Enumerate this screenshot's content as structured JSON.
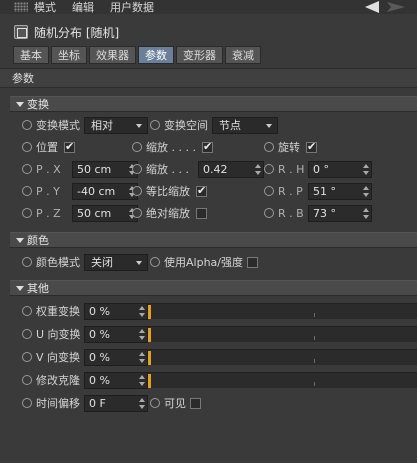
{
  "menu": {
    "items": [
      "模式",
      "编辑",
      "用户数据"
    ]
  },
  "title": "随机分布 [随机]",
  "tabs": [
    {
      "label": "基本",
      "active": false
    },
    {
      "label": "坐标",
      "active": false
    },
    {
      "label": "效果器",
      "active": false
    },
    {
      "label": "参数",
      "active": true
    },
    {
      "label": "变形器",
      "active": false
    },
    {
      "label": "衰减",
      "active": false
    }
  ],
  "params_header": "参数",
  "transform": {
    "header": "变换",
    "mode_label": "变换模式",
    "mode_value": "相对",
    "space_label": "变换空间",
    "space_value": "节点",
    "position_label": "位置",
    "position_checked": true,
    "scale_label": "缩放 . . . .",
    "scale_checked": true,
    "rotation_label": "旋转",
    "rotation_checked": true,
    "px_label": "P . X",
    "px_value": "50 cm",
    "py_label": "P . Y",
    "py_value": "-40 cm",
    "pz_label": "P . Z",
    "pz_value": "50 cm",
    "scale2_label": "缩放 . . .",
    "scale2_value": "0.42",
    "uniform_label": "等比缩放",
    "uniform_checked": true,
    "absolute_label": "绝对缩放",
    "absolute_checked": false,
    "rh_label": "R . H",
    "rh_value": "0 °",
    "rp_label": "R . P",
    "rp_value": "51 °",
    "rb_label": "R . B",
    "rb_value": "73 °"
  },
  "color": {
    "header": "颜色",
    "mode_label": "颜色模式",
    "mode_value": "关闭",
    "alpha_label": "使用Alpha/强度",
    "alpha_checked": false
  },
  "other": {
    "header": "其他",
    "weight_label": "权重变换",
    "weight_value": "0 %",
    "u_label": "U 向变换",
    "u_value": "0 %",
    "v_label": "V 向变换",
    "v_value": "0 %",
    "clone_label": "修改克隆",
    "clone_value": "0 %",
    "time_label": "时间偏移",
    "time_value": "0 F",
    "visible_label": "可见",
    "visible_checked": false
  },
  "colors": {
    "accent_tab": "#6a7f99",
    "slider_knob": "#e6a020",
    "panel_bg": "#3a3a3a"
  }
}
